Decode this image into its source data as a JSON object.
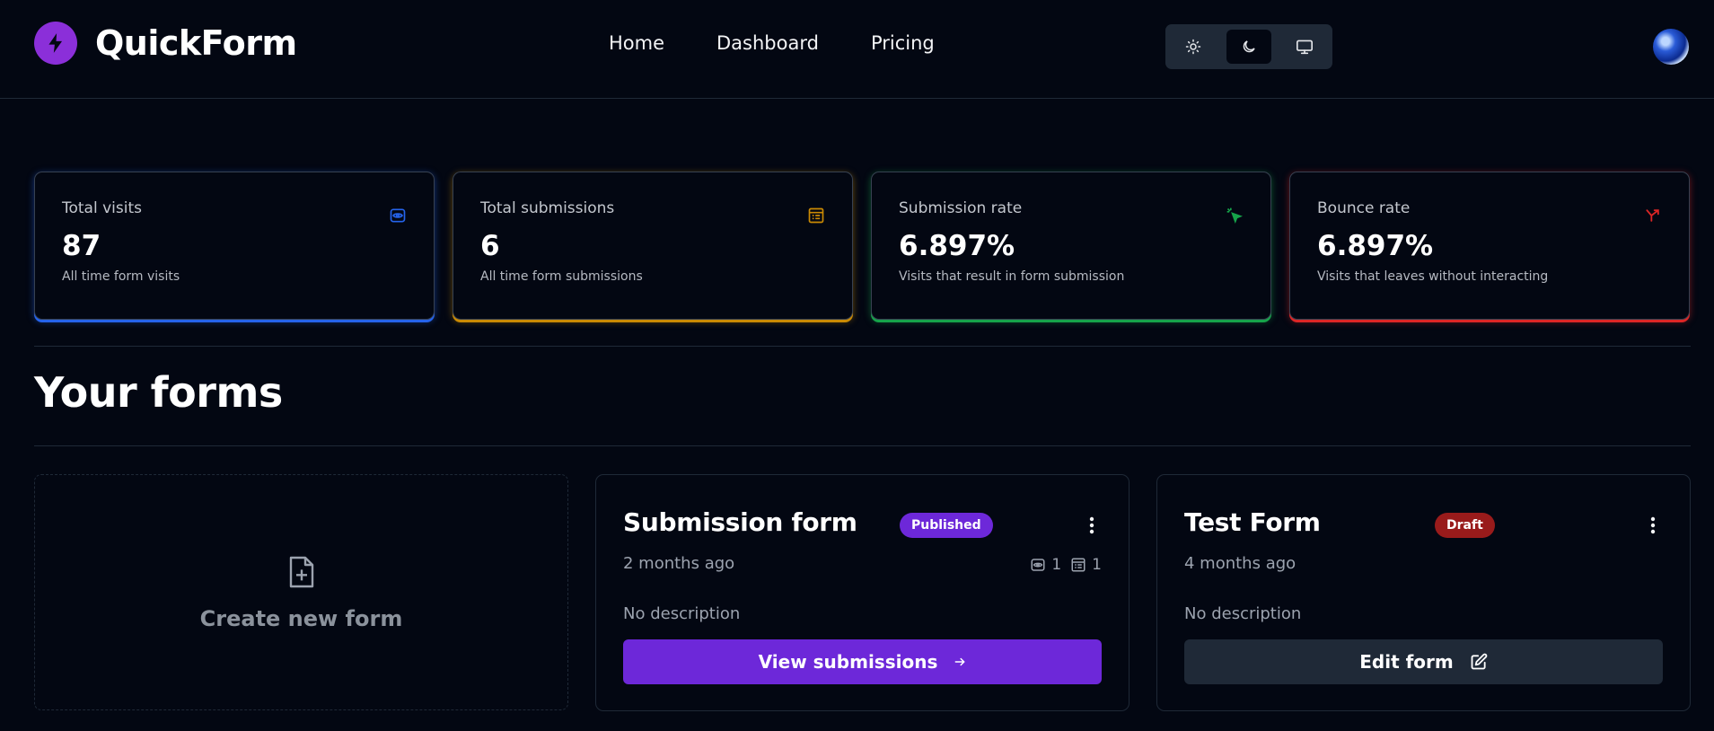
{
  "brand": {
    "name": "QuickForm",
    "accent": "#8b2fd9"
  },
  "nav": {
    "items": [
      "Home",
      "Dashboard",
      "Pricing"
    ]
  },
  "theme_toggle": {
    "options": [
      "light",
      "dark",
      "system"
    ],
    "selected": "dark"
  },
  "stats": [
    {
      "title": "Total visits",
      "value": "87",
      "helper": "All time form visits",
      "icon": "eye-icon",
      "color": "#2563eb"
    },
    {
      "title": "Total submissions",
      "value": "6",
      "helper": "All time form submissions",
      "icon": "form-icon",
      "color": "#ca8a04"
    },
    {
      "title": "Submission rate",
      "value": "6.897%",
      "helper": "Visits that result in form submission",
      "icon": "cursor-click-icon",
      "color": "#16a34a"
    },
    {
      "title": "Bounce rate",
      "value": "6.897%",
      "helper": "Visits that leaves without interacting",
      "icon": "split-arrow-icon",
      "color": "#dc2626"
    }
  ],
  "section": {
    "title": "Your forms"
  },
  "create_card": {
    "label": "Create new form"
  },
  "forms": [
    {
      "name": "Submission form",
      "status": "Published",
      "time": "2 months ago",
      "visits": "1",
      "submissions": "1",
      "description": "No description",
      "action": "View submissions"
    },
    {
      "name": "Test Form",
      "status": "Draft",
      "time": "4 months ago",
      "description": "No description",
      "action": "Edit form"
    }
  ]
}
